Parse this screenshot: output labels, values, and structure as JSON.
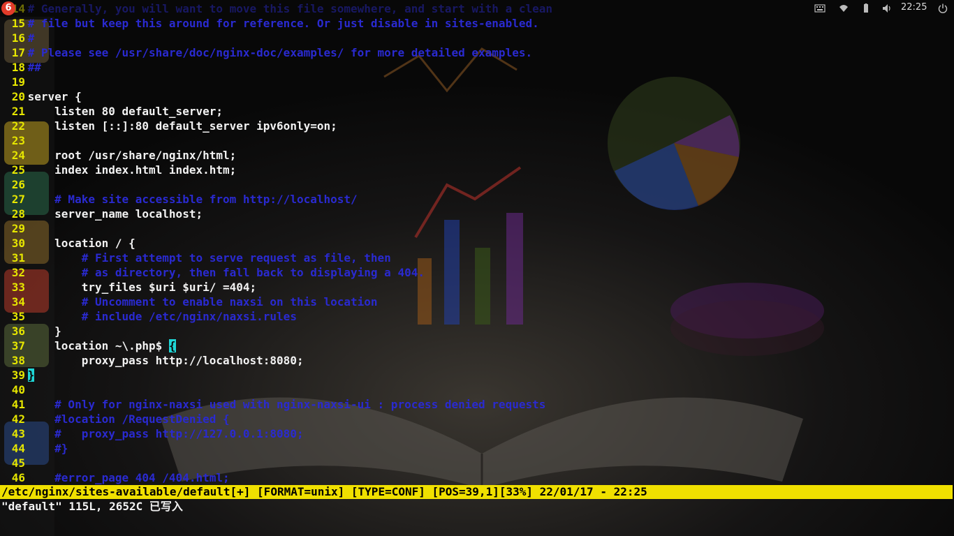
{
  "panel": {
    "clock": "22:25",
    "tray_icons": [
      "keyboard-icon",
      "wifi-icon",
      "battery-icon",
      "volume-icon",
      "power-icon"
    ]
  },
  "launcher": {
    "items": [
      "files",
      "chrome",
      "atom",
      "sublime-text",
      "netease-music",
      "book-reader",
      "workspace"
    ]
  },
  "editor": {
    "lines": [
      {
        "n": "14",
        "t": "# Generally, you will want to move this file somewhere, and start with a clean",
        "k": "comment"
      },
      {
        "n": "15",
        "t": "# file but keep this around for reference. Or just disable in sites-enabled.",
        "k": "comment"
      },
      {
        "n": "16",
        "t": "#",
        "k": "comment"
      },
      {
        "n": "17",
        "t": "# Please see /usr/share/doc/nginx-doc/examples/ for more detailed examples.",
        "k": "comment"
      },
      {
        "n": "18",
        "t": "##",
        "k": "comment"
      },
      {
        "n": "19",
        "t": "",
        "k": "code"
      },
      {
        "n": "20",
        "t": "server {",
        "k": "code"
      },
      {
        "n": "21",
        "t": "    listen 80 default_server;",
        "k": "code"
      },
      {
        "n": "22",
        "t": "    listen [::]:80 default_server ipv6only=on;",
        "k": "code"
      },
      {
        "n": "23",
        "t": "",
        "k": "code"
      },
      {
        "n": "24",
        "t": "    root /usr/share/nginx/html;",
        "k": "code"
      },
      {
        "n": "25",
        "t": "    index index.html index.htm;",
        "k": "code"
      },
      {
        "n": "26",
        "t": "",
        "k": "code"
      },
      {
        "n": "27",
        "t": "    # Make site accessible from http://localhost/",
        "k": "comment"
      },
      {
        "n": "28",
        "t": "    server_name localhost;",
        "k": "code"
      },
      {
        "n": "29",
        "t": "",
        "k": "code"
      },
      {
        "n": "30",
        "t": "    location / {",
        "k": "code"
      },
      {
        "n": "31",
        "t": "        # First attempt to serve request as file, then",
        "k": "comment"
      },
      {
        "n": "32",
        "t": "        # as directory, then fall back to displaying a 404.",
        "k": "comment"
      },
      {
        "n": "33",
        "t": "        try_files $uri $uri/ =404;",
        "k": "code"
      },
      {
        "n": "34",
        "t": "        # Uncomment to enable naxsi on this location",
        "k": "comment"
      },
      {
        "n": "35",
        "t": "        # include /etc/nginx/naxsi.rules",
        "k": "comment"
      },
      {
        "n": "36",
        "t": "    }",
        "k": "code"
      },
      {
        "n": "37",
        "t": "    location ~\\.php$ ",
        "k": "code",
        "brace": "{"
      },
      {
        "n": "38",
        "t": "        proxy_pass http://localhost:8080;",
        "k": "code"
      },
      {
        "n": "39",
        "t": "",
        "k": "code",
        "brace": "}"
      },
      {
        "n": "40",
        "t": "",
        "k": "code"
      },
      {
        "n": "41",
        "t": "    # Only for nginx-naxsi used with nginx-naxsi-ui : process denied requests",
        "k": "comment"
      },
      {
        "n": "42",
        "t": "    #location /RequestDenied {",
        "k": "comment"
      },
      {
        "n": "43",
        "t": "    #   proxy_pass http://127.0.0.1:8080;",
        "k": "comment"
      },
      {
        "n": "44",
        "t": "    #}",
        "k": "comment"
      },
      {
        "n": "45",
        "t": "",
        "k": "code"
      },
      {
        "n": "46",
        "t": "    #error_page 404 /404.html;",
        "k": "comment"
      }
    ]
  },
  "statusline": {
    "text": "/etc/nginx/sites-available/default[+] [FORMAT=unix] [TYPE=CONF] [POS=39,1][33%] 22/01/17 - 22:25"
  },
  "cmdline": {
    "text": "\"default\" 115L, 2652C 已写入"
  },
  "colors": {
    "line_numbers": "#e6e600",
    "comment": "#2a2ad0",
    "statusline_bg": "#f0e000",
    "cursor": "#1fd6d6"
  }
}
